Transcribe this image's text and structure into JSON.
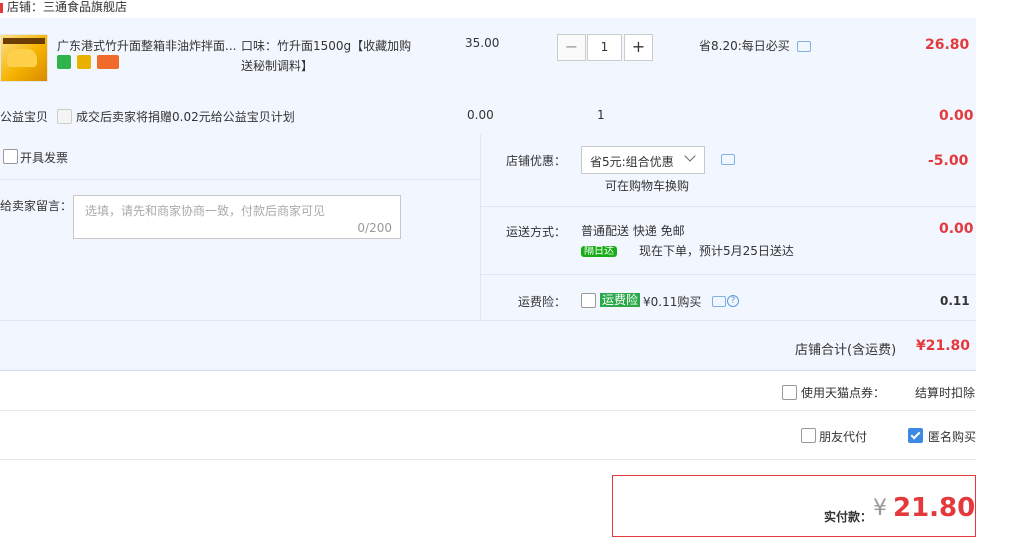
{
  "shop": {
    "label": "店铺：三通食品旗舰店"
  },
  "item": {
    "title": "广东港式竹升面整箱非油炸拌面...",
    "spec_line1": "口味：竹升面1500g【收藏加购",
    "spec_line2": "送秘制调料】",
    "unit_price": "35.00",
    "quantity": "1",
    "minus": "−",
    "plus": "+",
    "promo": "省8.20:每日必买",
    "total": "26.80"
  },
  "charity": {
    "label": "公益宝贝",
    "desc": "成交后卖家将捐赠0.02元给公益宝贝计划",
    "price": "0.00",
    "qty": "1",
    "total": "0.00"
  },
  "invoice": {
    "label": "开具发票"
  },
  "message": {
    "label": "给卖家留言：",
    "placeholder": "选填，请先和商家协商一致，付款后商家可见",
    "counter": "0/200"
  },
  "discount": {
    "label": "店铺优惠：",
    "selected": "省5元:组合优惠",
    "hint": "可在购物车换购",
    "amount": "-5.00"
  },
  "shipping": {
    "label": "运送方式：",
    "method": "普通配送 快递 免邮",
    "badge": "隔日达",
    "eta": "现在下单，预计5月25日送达",
    "amount": "0.00"
  },
  "insurance": {
    "label": "运费险：",
    "tag": "运费险",
    "price": "¥0.11购买",
    "amount": "0.11"
  },
  "shop_total": {
    "label": "店铺合计(含运费)",
    "amount": "¥21.80"
  },
  "points": {
    "label": "使用天猫点券：",
    "note": "结算时扣除"
  },
  "friend_pay": {
    "label": "朋友代付"
  },
  "anonymous": {
    "label": "匿名购买"
  },
  "pay": {
    "label": "实付款：",
    "currency": "¥",
    "amount": "21.80"
  },
  "colors": {
    "accent_red": "#e4393c",
    "panel_bg": "#f2f7ff",
    "checkbox_blue": "#3c89e3",
    "green_tag": "#2aa84a"
  }
}
